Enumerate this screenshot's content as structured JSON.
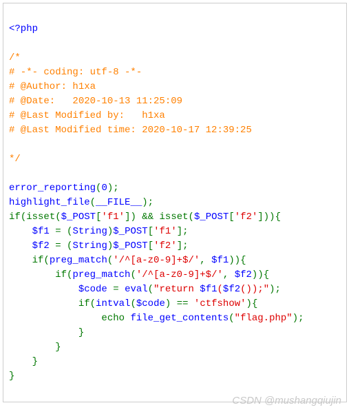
{
  "code": {
    "open_tag": "<?php",
    "comment": {
      "l1": "/*",
      "l2": "# -*- coding: utf-8 -*-",
      "l3": "# @Author: h1xa",
      "l4": "# @Date:   2020-10-13 11:25:09",
      "l5": "# @Last Modified by:   h1xa",
      "l6": "# @Last Modified time: 2020-10-17 12:39:25",
      "l7": "*/"
    },
    "fn_error_reporting": "error_reporting",
    "num_zero": "0",
    "fn_highlight_file": "highlight_file",
    "const_file": "__FILE__",
    "kw_if": "if",
    "fn_isset": "isset",
    "var_post": "$_POST",
    "str_f1": "'f1'",
    "str_f2": "'f2'",
    "op_and": "&&",
    "var_f1": "$f1",
    "var_f2": "$f2",
    "cast_string": "String",
    "fn_preg_match": "preg_match",
    "str_regex": "'/^[a-z0-9]+$/'",
    "var_code": "$code",
    "fn_eval": "eval",
    "str_eval_p1": "\"return ",
    "str_eval_p2": "(",
    "str_eval_p3": "());\"",
    "fn_intval": "intval",
    "str_ctfshow": "'ctfshow'",
    "kw_echo": "echo",
    "fn_file_get_contents": "file_get_contents",
    "str_flag": "\"flag.php\"",
    "op_eq": "==",
    "op_assign": "="
  },
  "watermark": "CSDN @mushangqiujin"
}
